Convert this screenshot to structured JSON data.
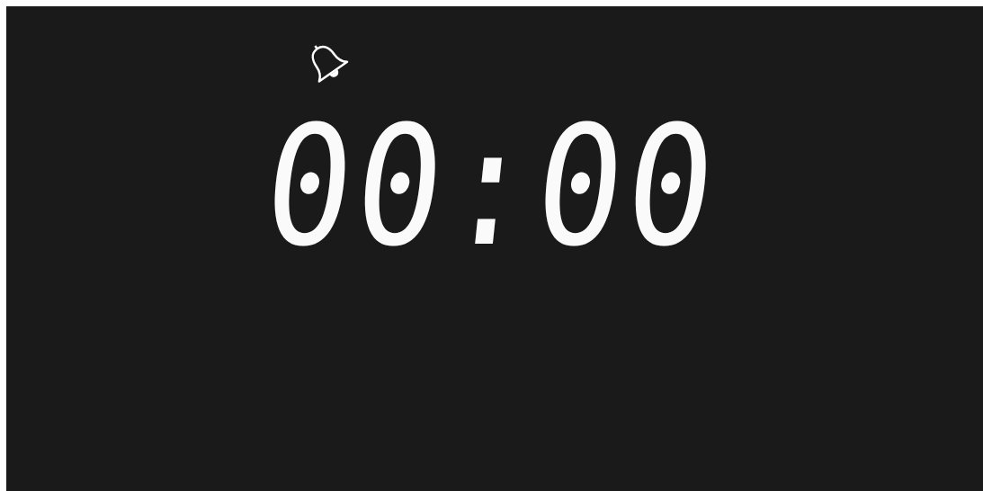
{
  "display": {
    "time": "00:00"
  }
}
